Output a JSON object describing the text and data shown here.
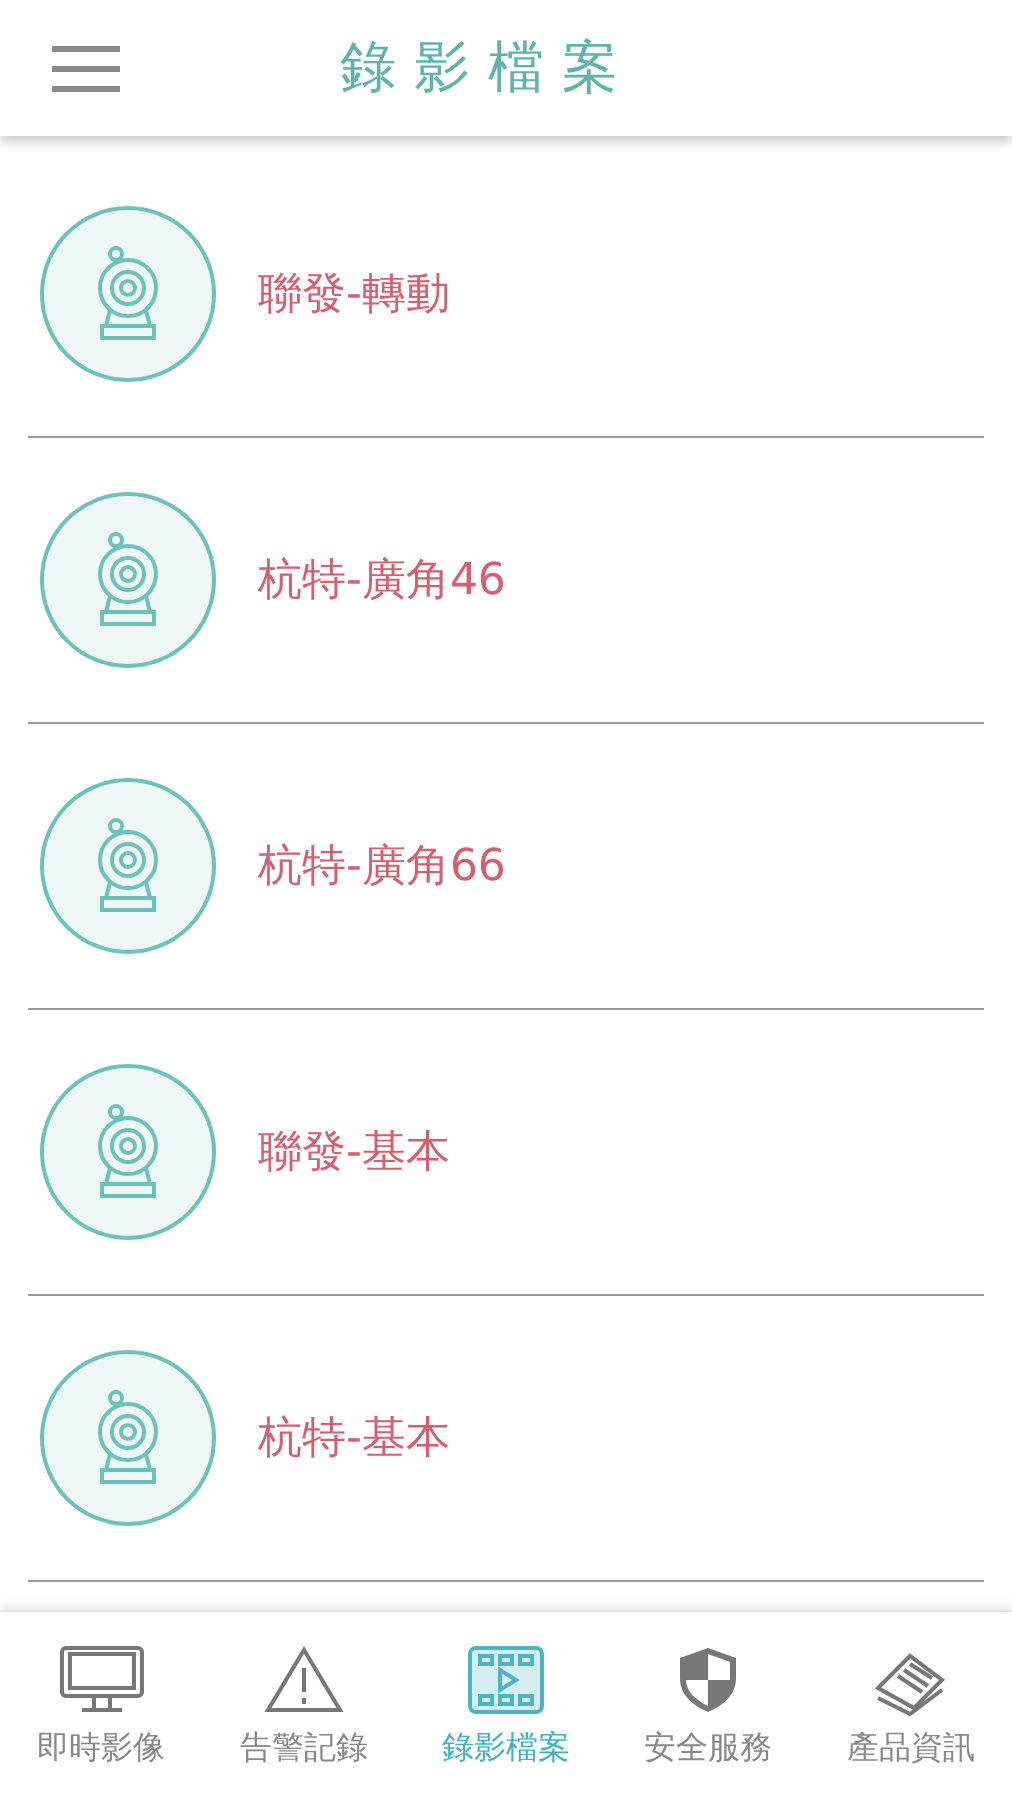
{
  "header": {
    "title": "錄影檔案"
  },
  "cameras": [
    {
      "name": "聯發-轉動"
    },
    {
      "name": "杭特-廣角46"
    },
    {
      "name": "杭特-廣角66"
    },
    {
      "name": "聯發-基本"
    },
    {
      "name": "杭特-基本"
    }
  ],
  "tabs": [
    {
      "label": "即時影像",
      "kind": "monitor",
      "selected": false
    },
    {
      "label": "告警記錄",
      "kind": "warning",
      "selected": false
    },
    {
      "label": "錄影檔案",
      "kind": "film",
      "selected": true
    },
    {
      "label": "安全服務",
      "kind": "shield",
      "selected": false
    },
    {
      "label": "產品資訊",
      "kind": "cards",
      "selected": false
    }
  ]
}
